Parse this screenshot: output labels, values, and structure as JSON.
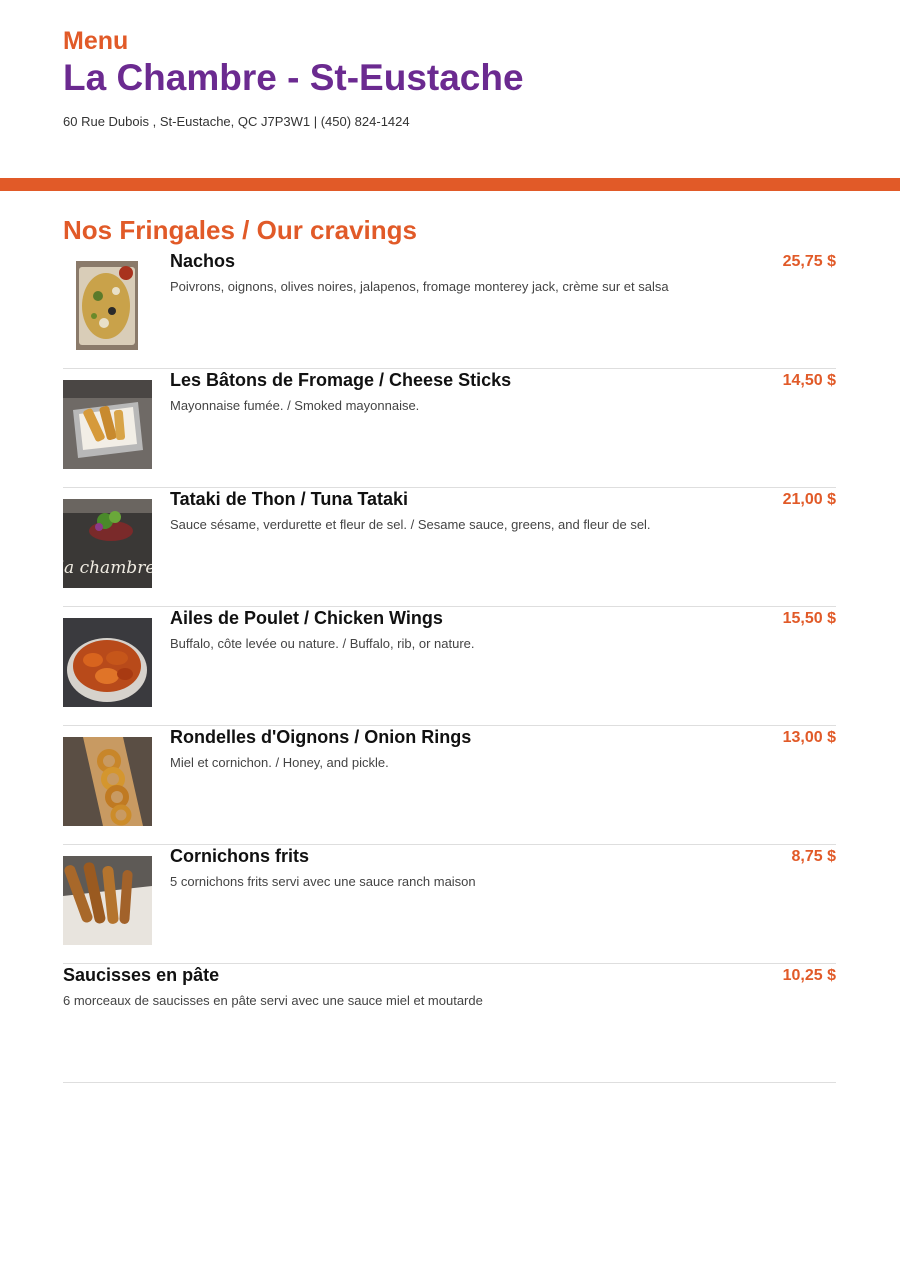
{
  "header": {
    "menu_label": "Menu",
    "restaurant_name": "La Chambre - St-Eustache",
    "address_line": "60 Rue Dubois , St-Eustache, QC J7P3W1 | (450) 824-1424"
  },
  "colors": {
    "accent": "#e15a28",
    "brand": "#6b2a90"
  },
  "section": {
    "title": "Nos Fringales / Our cravings",
    "items": [
      {
        "name": "Nachos",
        "description": "Poivrons, oignons, olives noires, jalapenos, fromage monterey jack, crème sur et salsa",
        "price": "25,75 $"
      },
      {
        "name": "Les Bâtons de Fromage / Cheese Sticks",
        "description": "Mayonnaise fumée. / Smoked mayonnaise.",
        "price": "14,50 $"
      },
      {
        "name": "Tataki de Thon / Tuna Tataki",
        "description": "Sauce sésame, verdurette et fleur de sel. / Sesame sauce, greens, and fleur de sel.",
        "price": "21,00 $",
        "image_text": "la chambre"
      },
      {
        "name": "Ailes de Poulet / Chicken Wings",
        "description": "Buffalo, côte levée ou nature. / Buffalo, rib, or nature.",
        "price": "15,50 $"
      },
      {
        "name": "Rondelles d'Oignons / Onion Rings",
        "description": "Miel et cornichon. / Honey, and pickle.",
        "price": "13,00 $"
      },
      {
        "name": "Cornichons frits",
        "description": "5 cornichons frits servi avec une sauce ranch maison",
        "price": "8,75 $"
      },
      {
        "name": "Saucisses en pâte",
        "description": "6 morceaux de saucisses en pâte servi avec une sauce miel et moutarde",
        "price": "10,25 $"
      }
    ]
  }
}
